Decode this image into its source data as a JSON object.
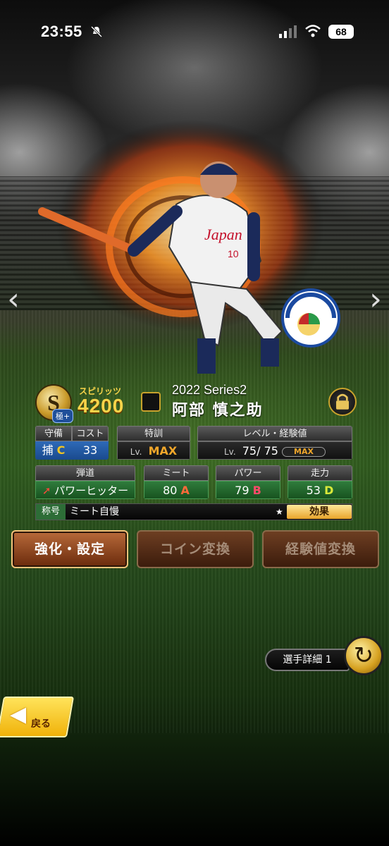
{
  "status_bar": {
    "time": "23:55",
    "battery": "68"
  },
  "player": {
    "rank": "S",
    "rank_sub": "極+",
    "spirits_label": "スピリッツ",
    "spirits": "4200",
    "series": "2022 Series2",
    "name": "阿部 慎之助"
  },
  "stats": {
    "position": {
      "label": "守備",
      "value": "捕",
      "grade": "C"
    },
    "cost": {
      "label": "コスト",
      "value": "33"
    },
    "training": {
      "label": "特訓",
      "lv": "Lv.",
      "value": "MAX"
    },
    "level": {
      "label": "レベル・経験値",
      "lv": "Lv.",
      "value": "75/ 75",
      "bar": "MAX"
    },
    "trajectory": {
      "label": "弾道",
      "value": "パワーヒッター"
    },
    "meet": {
      "label": "ミート",
      "value": "80",
      "grade": "A"
    },
    "power": {
      "label": "パワー",
      "value": "79",
      "grade": "B"
    },
    "speed": {
      "label": "走力",
      "value": "53",
      "grade": "D"
    }
  },
  "title_row": {
    "label": "称号",
    "value": "ミート自慢",
    "star": "★",
    "effect": "効果"
  },
  "actions": {
    "enhance": "強化・設定",
    "coin": "コイン変換",
    "exp": "経験値変換"
  },
  "detail": "選手詳細 1",
  "back": "戻る",
  "icons": {
    "nav_left": "‹",
    "nav_right": "›"
  },
  "colors": {
    "accent": "#f0a62a",
    "green_panel": "#2f7c3c",
    "blue_panel": "#2e6ab8"
  }
}
